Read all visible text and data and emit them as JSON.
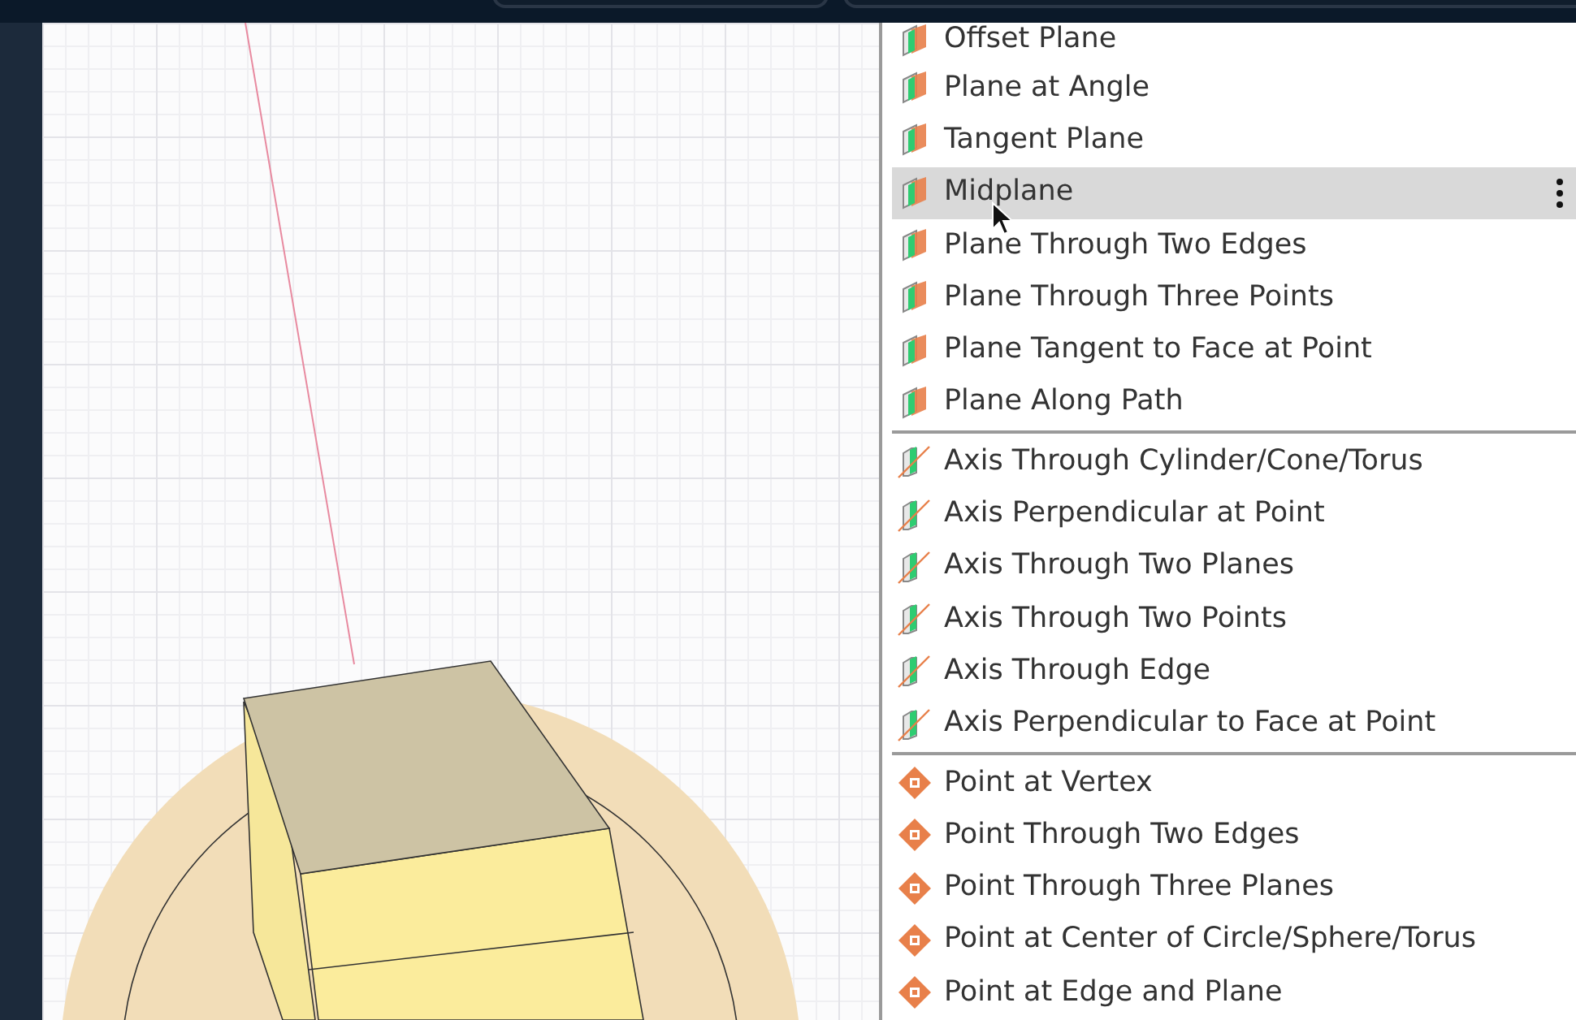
{
  "menu": {
    "groups": [
      {
        "kind": "plane",
        "items": [
          {
            "label": "Offset Plane",
            "selected": false
          },
          {
            "label": "Plane at Angle",
            "selected": false
          },
          {
            "label": "Tangent Plane",
            "selected": false
          },
          {
            "label": "Midplane",
            "selected": true
          },
          {
            "label": "Plane Through Two Edges",
            "selected": false
          },
          {
            "label": "Plane Through Three Points",
            "selected": false
          },
          {
            "label": "Plane Tangent to Face at Point",
            "selected": false
          },
          {
            "label": "Plane Along Path",
            "selected": false
          }
        ]
      },
      {
        "kind": "axis",
        "items": [
          {
            "label": "Axis Through Cylinder/Cone/Torus",
            "selected": false
          },
          {
            "label": "Axis Perpendicular at Point",
            "selected": false
          },
          {
            "label": "Axis Through Two Planes",
            "selected": false
          },
          {
            "label": "Axis Through Two Points",
            "selected": false
          },
          {
            "label": "Axis Through Edge",
            "selected": false
          },
          {
            "label": "Axis Perpendicular to Face at Point",
            "selected": false
          }
        ]
      },
      {
        "kind": "point",
        "items": [
          {
            "label": "Point at Vertex",
            "selected": false
          },
          {
            "label": "Point Through Two Edges",
            "selected": false
          },
          {
            "label": "Point Through Three Planes",
            "selected": false
          },
          {
            "label": "Point at Center of Circle/Sphere/Torus",
            "selected": false
          },
          {
            "label": "Point at Edge and Plane",
            "selected": false
          }
        ]
      }
    ]
  }
}
